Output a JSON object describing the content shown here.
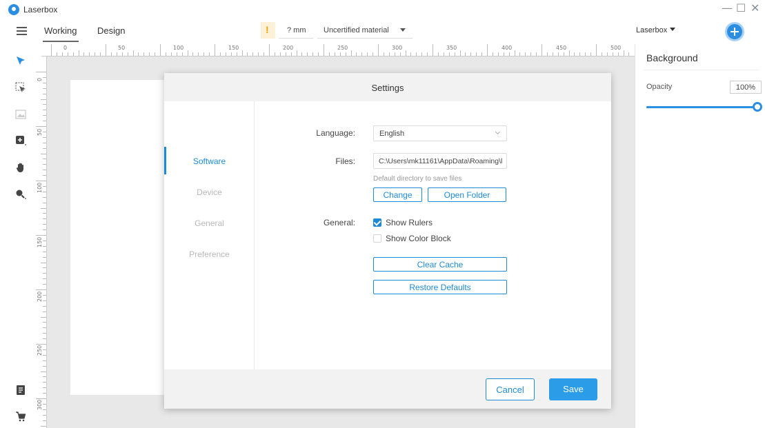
{
  "titlebar": {
    "app_name": "Laserbox",
    "minimize_symbol": "—",
    "maximize_symbol": "☐",
    "close_symbol": "✕"
  },
  "menubar": {
    "tabs": [
      {
        "label": "Working",
        "active": true
      },
      {
        "label": "Design",
        "active": false
      }
    ],
    "warning_symbol": "!",
    "thickness": "? mm",
    "material": "Uncertified material",
    "device": "Laserbox"
  },
  "ruler": {
    "horizontal_labels": [
      "0",
      "50",
      "100",
      "150",
      "200",
      "250",
      "300",
      "350",
      "400",
      "450",
      "500"
    ],
    "vertical_labels": [
      "0",
      "50",
      "100",
      "150",
      "200",
      "250",
      "300"
    ]
  },
  "left_toolbar": {
    "tools": [
      "select-icon",
      "multi-select-icon",
      "image-icon",
      "add-shape-icon",
      "hand-pan-icon",
      "zoom-icon",
      "notes-icon",
      "cart-icon"
    ]
  },
  "right_panel": {
    "title": "Background",
    "opacity_label": "Opacity",
    "opacity_value": "100%",
    "opacity_fraction": 1.0,
    "accent_color": "#2b8ee0"
  },
  "settings_dialog": {
    "title": "Settings",
    "nav": [
      {
        "label": "Software",
        "active": true
      },
      {
        "label": "Device",
        "active": false
      },
      {
        "label": "General",
        "active": false
      },
      {
        "label": "Preference",
        "active": false
      }
    ],
    "language_label": "Language:",
    "language_value": "English",
    "files_label": "Files:",
    "files_path": "C:\\Users\\mk11161\\AppData\\Roaming\\l",
    "files_hint": "Default directory to save files",
    "change_button": "Change",
    "open_folder_button": "Open Folder",
    "general_label": "General:",
    "show_rulers_label": "Show Rulers",
    "show_rulers_checked": true,
    "show_color_block_label": "Show Color Block",
    "show_color_block_checked": false,
    "clear_cache_button": "Clear Cache",
    "restore_defaults_button": "Restore Defaults",
    "cancel_button": "Cancel",
    "save_button": "Save"
  }
}
